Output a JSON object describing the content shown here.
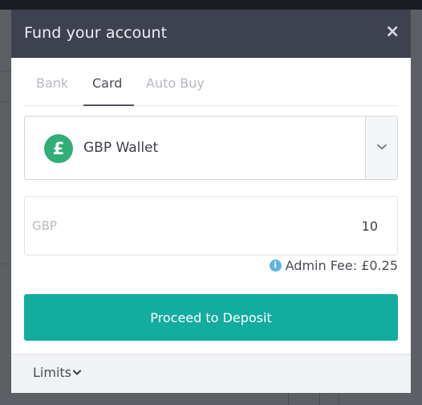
{
  "modal": {
    "title": "Fund your account",
    "close_icon": "close-icon",
    "close_glyph": "×"
  },
  "tabs": [
    {
      "label": "Bank",
      "active": false
    },
    {
      "label": "Card",
      "active": true
    },
    {
      "label": "Auto Buy",
      "active": false
    }
  ],
  "wallet": {
    "icon": "pound-sign-icon",
    "icon_glyph": "£",
    "icon_color": "#2fae76",
    "label": "GBP Wallet",
    "arrow_icon": "chevron-down-icon"
  },
  "amount": {
    "currency": "GBP",
    "value": "10"
  },
  "fee": {
    "icon": "info-icon",
    "icon_glyph": "i",
    "text": "Admin Fee: £0.25"
  },
  "deposit_button": {
    "label": "Proceed to Deposit",
    "color": "#12ad9f"
  },
  "footer": {
    "limits_label": "Limits",
    "limits_icon": "chevron-down-icon"
  },
  "colors": {
    "header_bg": "#3e4150",
    "accent": "#12ad9f"
  }
}
